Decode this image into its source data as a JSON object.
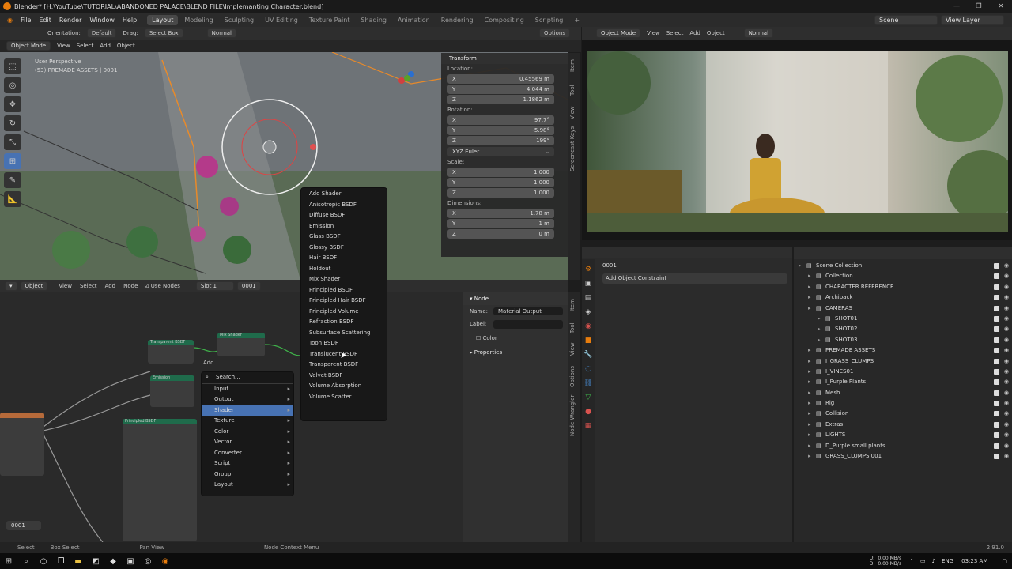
{
  "titlebar": {
    "title": "Blender* [H:\\YouTube\\TUTORIAL\\ABANDONED PALACE\\BLEND FILE\\Implemanting Character.blend]"
  },
  "menu": [
    "File",
    "Edit",
    "Render",
    "Window",
    "Help"
  ],
  "workspaces": [
    "Layout",
    "Modeling",
    "Sculpting",
    "UV Editing",
    "Texture Paint",
    "Shading",
    "Animation",
    "Rendering",
    "Compositing",
    "Scripting"
  ],
  "scene": {
    "name": "Scene",
    "view_layer": "View Layer"
  },
  "toolheader": {
    "orientation_label": "Orientation:",
    "orientation": "Default",
    "drag_label": "Drag:",
    "drag": "Select Box",
    "pivot": "Normal",
    "options": "Options"
  },
  "viewport": {
    "mode": "Object Mode",
    "menus": [
      "View",
      "Select",
      "Add",
      "Object"
    ],
    "perspective": "User Perspective",
    "collection_info": "(53) PREMADE ASSETS | 0001"
  },
  "transform": {
    "title": "Transform",
    "location_label": "Location:",
    "location": [
      {
        "axis": "X",
        "value": "0.45569 m"
      },
      {
        "axis": "Y",
        "value": "4.044 m"
      },
      {
        "axis": "Z",
        "value": "1.1862 m"
      }
    ],
    "rotation_label": "Rotation:",
    "rotation": [
      {
        "axis": "X",
        "value": "97.7°"
      },
      {
        "axis": "Y",
        "value": "-5.98°"
      },
      {
        "axis": "Z",
        "value": "199°"
      }
    ],
    "rotation_mode": "XYZ Euler",
    "scale_label": "Scale:",
    "scale": [
      {
        "axis": "X",
        "value": "1.000"
      },
      {
        "axis": "Y",
        "value": "1.000"
      },
      {
        "axis": "Z",
        "value": "1.000"
      }
    ],
    "dimensions_label": "Dimensions:",
    "dimensions": [
      {
        "axis": "X",
        "value": "1.78 m"
      },
      {
        "axis": "Y",
        "value": "1 m"
      },
      {
        "axis": "Z",
        "value": "0 m"
      }
    ]
  },
  "sidebar_tabs": [
    "Item",
    "Tool",
    "View",
    "Screencast Keys"
  ],
  "render_header": {
    "mode": "Object Mode",
    "menus": [
      "View",
      "Select",
      "Add",
      "Object"
    ],
    "pivot": "Normal"
  },
  "node_editor": {
    "header": {
      "type": "Object",
      "menus": [
        "View",
        "Select",
        "Add",
        "Node"
      ],
      "use_nodes": "Use Nodes",
      "slot": "Slot 1",
      "material": "0001"
    },
    "node_titles": [
      "Transparent BSDF",
      "Mix Shader",
      "Emission",
      "Principled BSDF"
    ],
    "add_label": "Add",
    "frame_value": "0001"
  },
  "add_menu": {
    "search": "Search...",
    "items": [
      "Input",
      "Output",
      "Shader",
      "Texture",
      "Color",
      "Vector",
      "Converter",
      "Script",
      "Group",
      "Layout"
    ],
    "highlighted": "Shader"
  },
  "shader_menu": {
    "items": [
      "Add Shader",
      "Anisotropic BSDF",
      "Diffuse BSDF",
      "Emission",
      "Glass BSDF",
      "Glossy BSDF",
      "Hair BSDF",
      "Holdout",
      "Mix Shader",
      "Principled BSDF",
      "Principled Hair BSDF",
      "Principled Volume",
      "Refraction BSDF",
      "Subsurface Scattering",
      "Toon BSDF",
      "Translucent BSDF",
      "Transparent BSDF",
      "Velvet BSDF",
      "Volume Absorption",
      "Volume Scatter"
    ]
  },
  "node_panel": {
    "section": "Node",
    "name_label": "Name:",
    "name": "Material Output",
    "label_label": "Label:",
    "color": "Color",
    "properties": "Properties",
    "tabs": [
      "Item",
      "Tool",
      "View",
      "Options",
      "Node Wrangler"
    ]
  },
  "properties": {
    "object": "0001",
    "add_constraint": "Add Object Constraint"
  },
  "outliner": {
    "rows": [
      {
        "name": "Scene Collection",
        "indent": 0
      },
      {
        "name": "Collection",
        "indent": 1
      },
      {
        "name": "CHARACTER REFERENCE",
        "indent": 1
      },
      {
        "name": "Archipack",
        "indent": 1
      },
      {
        "name": "CAMERAS",
        "indent": 1
      },
      {
        "name": "SHOT01",
        "indent": 2
      },
      {
        "name": "SHOT02",
        "indent": 2
      },
      {
        "name": "SHOT03",
        "indent": 2
      },
      {
        "name": "PREMADE ASSETS",
        "indent": 1
      },
      {
        "name": "I_GRASS_CLUMPS",
        "indent": 1
      },
      {
        "name": "I_VINES01",
        "indent": 1
      },
      {
        "name": "I_Purple Plants",
        "indent": 1
      },
      {
        "name": "Mesh",
        "indent": 1
      },
      {
        "name": "Rig",
        "indent": 1
      },
      {
        "name": "Collision",
        "indent": 1
      },
      {
        "name": "Extras",
        "indent": 1
      },
      {
        "name": "LIGHTS",
        "indent": 1
      },
      {
        "name": "D_Purple small plants",
        "indent": 1
      },
      {
        "name": "GRASS_CLUMPS.001",
        "indent": 1
      }
    ]
  },
  "statusbar": {
    "select": "Select",
    "box_select": "Box Select",
    "pan_view": "Pan View",
    "context": "Node Context Menu",
    "version": "2.91.0"
  },
  "taskbar": {
    "net_up": "0.00 MB/s",
    "net_down": "0.00 MB/s",
    "u": "U:",
    "d": "D:",
    "lang": "ENG",
    "time": "03:23 AM"
  },
  "colors": {
    "accent": "#4772b3",
    "orange": "#e87d0d",
    "node_green": "#1f6b4b",
    "node_teal": "#2a8a6f"
  }
}
